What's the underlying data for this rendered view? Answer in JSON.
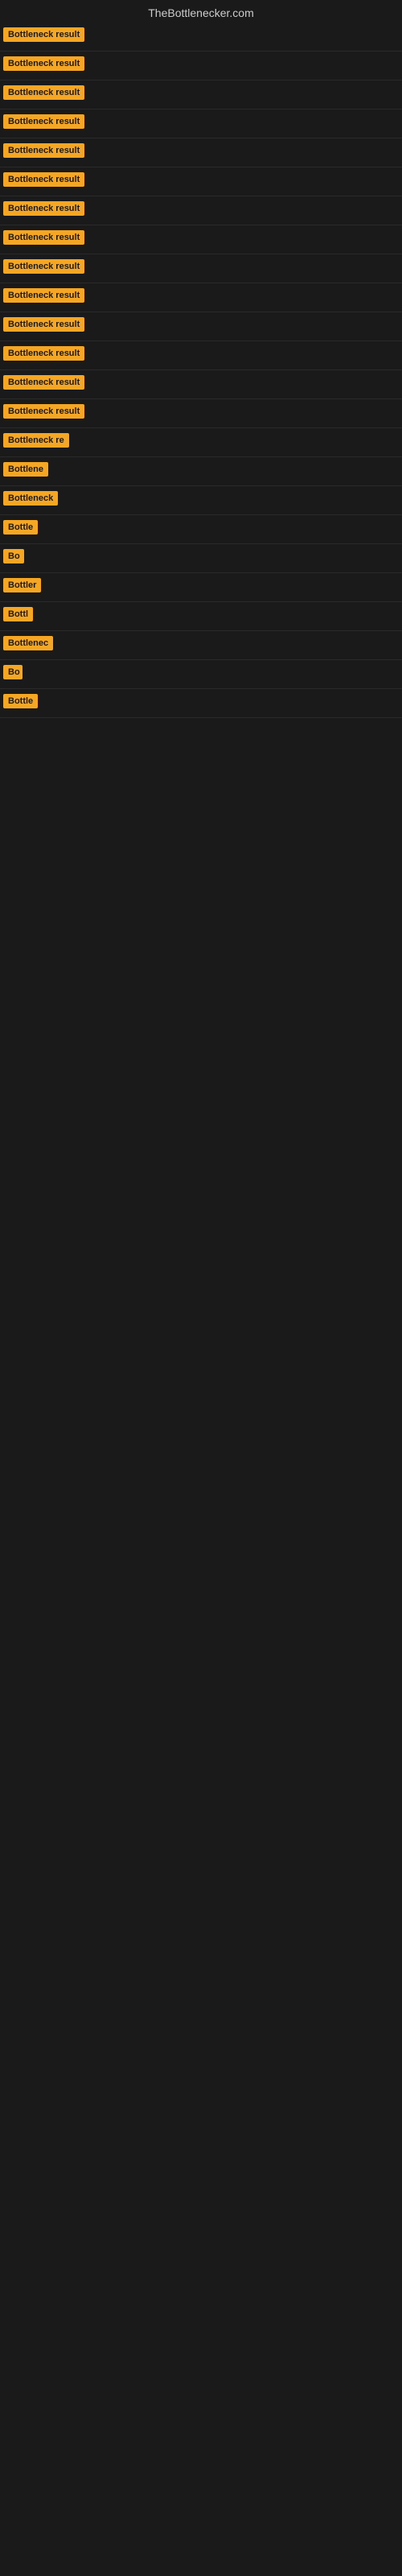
{
  "site": {
    "title": "TheBottlenecker.com"
  },
  "results": [
    {
      "id": 1,
      "label": "Bottleneck result",
      "width": 120
    },
    {
      "id": 2,
      "label": "Bottleneck result",
      "width": 120
    },
    {
      "id": 3,
      "label": "Bottleneck result",
      "width": 120
    },
    {
      "id": 4,
      "label": "Bottleneck result",
      "width": 120
    },
    {
      "id": 5,
      "label": "Bottleneck result",
      "width": 120
    },
    {
      "id": 6,
      "label": "Bottleneck result",
      "width": 120
    },
    {
      "id": 7,
      "label": "Bottleneck result",
      "width": 120
    },
    {
      "id": 8,
      "label": "Bottleneck result",
      "width": 120
    },
    {
      "id": 9,
      "label": "Bottleneck result",
      "width": 120
    },
    {
      "id": 10,
      "label": "Bottleneck result",
      "width": 120
    },
    {
      "id": 11,
      "label": "Bottleneck result",
      "width": 120
    },
    {
      "id": 12,
      "label": "Bottleneck result",
      "width": 118
    },
    {
      "id": 13,
      "label": "Bottleneck result",
      "width": 115
    },
    {
      "id": 14,
      "label": "Bottleneck result",
      "width": 112
    },
    {
      "id": 15,
      "label": "Bottleneck re",
      "width": 90
    },
    {
      "id": 16,
      "label": "Bottlene",
      "width": 72
    },
    {
      "id": 17,
      "label": "Bottleneck",
      "width": 80
    },
    {
      "id": 18,
      "label": "Bottle",
      "width": 58
    },
    {
      "id": 19,
      "label": "Bo",
      "width": 26
    },
    {
      "id": 20,
      "label": "Bottler",
      "width": 55
    },
    {
      "id": 21,
      "label": "Bottl",
      "width": 46
    },
    {
      "id": 22,
      "label": "Bottlenec",
      "width": 75
    },
    {
      "id": 23,
      "label": "Bo",
      "width": 24
    },
    {
      "id": 24,
      "label": "Bottle",
      "width": 52
    }
  ]
}
